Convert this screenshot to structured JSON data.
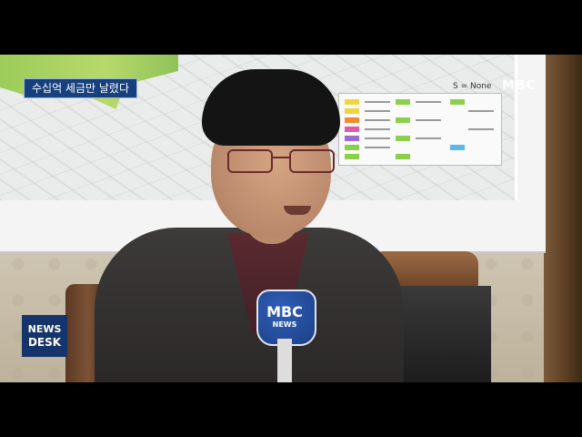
{
  "caption": {
    "text": "수십억 세금만 날렸다"
  },
  "watermark": {
    "text": "MBC"
  },
  "map_note": {
    "text": "S = None"
  },
  "news_desk": {
    "line1": "NEWS",
    "line2": "DESK"
  },
  "microphone": {
    "brand": "MBC",
    "sub": "NEWS"
  },
  "colors": {
    "caption_bg": "#16407e",
    "mic_blue": "#1c3f86",
    "map_green": "#9ccc5a"
  }
}
